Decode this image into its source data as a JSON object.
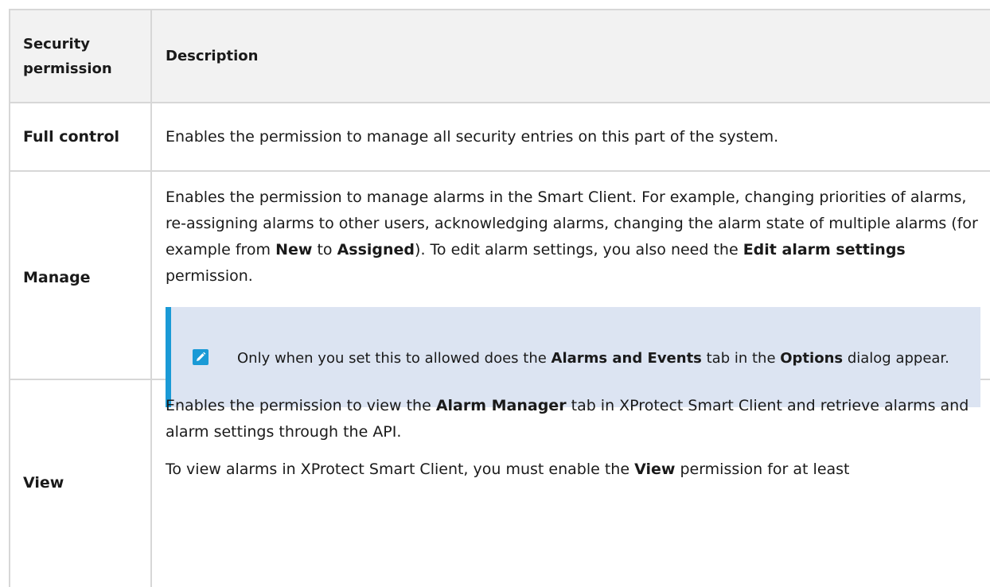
{
  "table": {
    "headers": {
      "permission": "Security permission",
      "description": "Description"
    },
    "rows": [
      {
        "permission": "Full control",
        "description": "Enables the permission to manage all security entries on this part of the system."
      },
      {
        "permission": "Manage",
        "desc_a": "Enables the permission to manage alarms in the Smart Client. For example, changing priorities of alarms, re-assigning alarms to other users, acknowledging alarms, changing the alarm state of multiple alarms (for example from ",
        "desc_b": "New",
        "desc_c": " to ",
        "desc_d": "Assigned",
        "desc_e": "). To edit alarm settings, you also need the ",
        "desc_f": "Edit alarm settings",
        "desc_g": " permission.",
        "note": {
          "icon": "pencil-icon",
          "a": "Only when you set this to allowed does the ",
          "b": "Alarms and Events",
          "c": " tab in the ",
          "d": "Options",
          "e": " dialog appear."
        }
      },
      {
        "permission": "View",
        "p1_a": "Enables the permission to view the ",
        "p1_b": "Alarm Manager",
        "p1_c": " tab in XProtect Smart Client and retrieve alarms and alarm settings through the API.",
        "p2_a": "To view alarms in XProtect Smart Client, you must enable the ",
        "p2_b": "View",
        "p2_c": " permission for at least"
      }
    ]
  },
  "colors": {
    "note_bg": "#dce4f2",
    "note_accent": "#1a9ad6",
    "header_bg": "#f2f2f2",
    "border": "#d7d7d7"
  }
}
